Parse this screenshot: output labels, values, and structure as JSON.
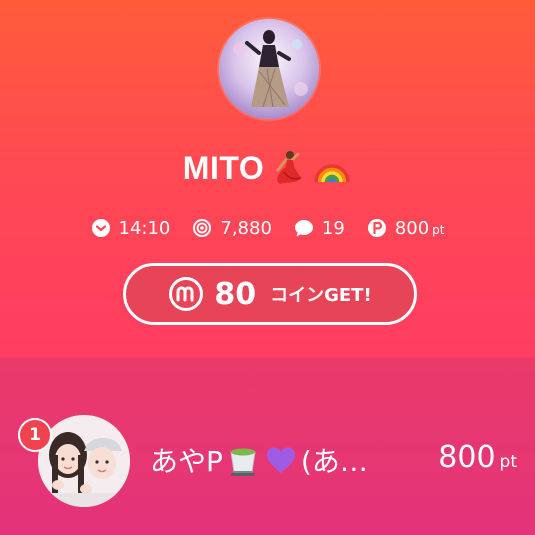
{
  "profile": {
    "name": "MITO",
    "avatar_icon": "profile-avatar",
    "name_emojis": [
      "dancer-emoji",
      "rainbow-emoji"
    ]
  },
  "stats": {
    "time": {
      "icon": "chevron-down-circle-icon",
      "value": "14:10"
    },
    "views": {
      "icon": "radar-icon",
      "value": "7,880"
    },
    "comments": {
      "icon": "speech-bubble-icon",
      "value": "19"
    },
    "points": {
      "icon": "p-coin-icon",
      "value": "800",
      "unit": "pt"
    }
  },
  "coin_button": {
    "icon": "m-coin-icon",
    "amount": "80",
    "label": "コインGET!"
  },
  "ranking": [
    {
      "rank": "1",
      "name_prefix": "あやP",
      "name_suffix": "(あ…",
      "name_emojis": [
        "green-tea-emoji",
        "purple-heart-emoji"
      ],
      "points": "800",
      "unit": "pt"
    }
  ],
  "colors": {
    "top_gradient_start": "#ff5c3a",
    "top_gradient_end": "#ff3c62",
    "bottom_band": "#e3337a",
    "button_fill": "#e84458",
    "rank_badge": "#f0434f"
  }
}
